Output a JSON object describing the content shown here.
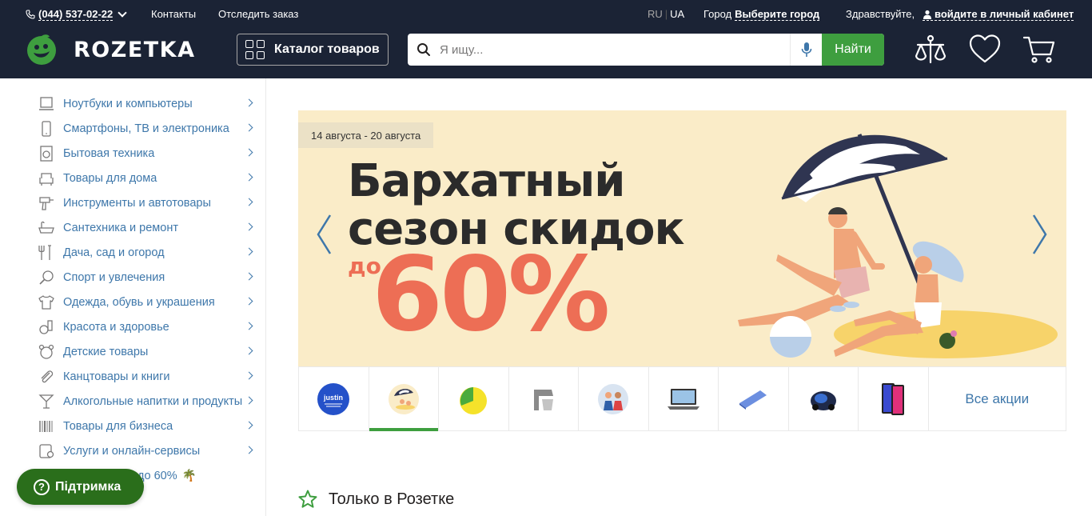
{
  "topbar": {
    "phone": "(044) 537-02-22",
    "contacts": "Контакты",
    "track": "Отследить заказ",
    "lang_ru": "RU",
    "lang_ua": "UA",
    "city_label": "Город",
    "city_value": "Выберите город",
    "greeting": "Здравствуйте,",
    "login": "войдите в личный кабинет"
  },
  "header": {
    "logo": "ROZETKA",
    "catalog": "Каталог товаров",
    "search_placeholder": "Я ищу...",
    "search_button": "Найти"
  },
  "sidebar": {
    "items": [
      {
        "label": "Ноутбуки и компьютеры",
        "icon": "laptop-icon"
      },
      {
        "label": "Смартфоны, ТВ и электроника",
        "icon": "smartphone-icon"
      },
      {
        "label": "Бытовая техника",
        "icon": "washer-icon"
      },
      {
        "label": "Товары для дома",
        "icon": "armchair-icon"
      },
      {
        "label": "Инструменты и автотовары",
        "icon": "drill-icon"
      },
      {
        "label": "Сантехника и ремонт",
        "icon": "bathtub-icon"
      },
      {
        "label": "Дача, сад и огород",
        "icon": "garden-icon"
      },
      {
        "label": "Спорт и увлечения",
        "icon": "racket-icon"
      },
      {
        "label": "Одежда, обувь и украшения",
        "icon": "tshirt-icon"
      },
      {
        "label": "Красота и здоровье",
        "icon": "cosmetics-icon"
      },
      {
        "label": "Детские товары",
        "icon": "teddy-icon"
      },
      {
        "label": "Канцтовары и книги",
        "icon": "paperclip-icon"
      },
      {
        "label": "Алкогольные напитки и продукты",
        "icon": "cocktail-icon"
      },
      {
        "label": "Товары для бизнеса",
        "icon": "barcode-icon"
      },
      {
        "label": "Услуги и онлайн-сервисы",
        "icon": "services-icon"
      }
    ],
    "promo": "идки до 60%",
    "promo_emoji": "🌴",
    "support": "Підтримка"
  },
  "banner": {
    "date": "14 августа - 20 августа",
    "title_line1": "Бархатный",
    "title_line2": "сезон скидок",
    "prefix": "до",
    "percent": "60%"
  },
  "thumbs": {
    "all": "Все акции",
    "justin": "justin"
  },
  "section": {
    "title": "Только в Розетке"
  },
  "colors": {
    "header_bg": "#1b2335",
    "accent_green": "#3e9e3f",
    "link_blue": "#3e77aa",
    "banner_bg": "#faecc8",
    "promo_orange": "#ed6e55"
  }
}
